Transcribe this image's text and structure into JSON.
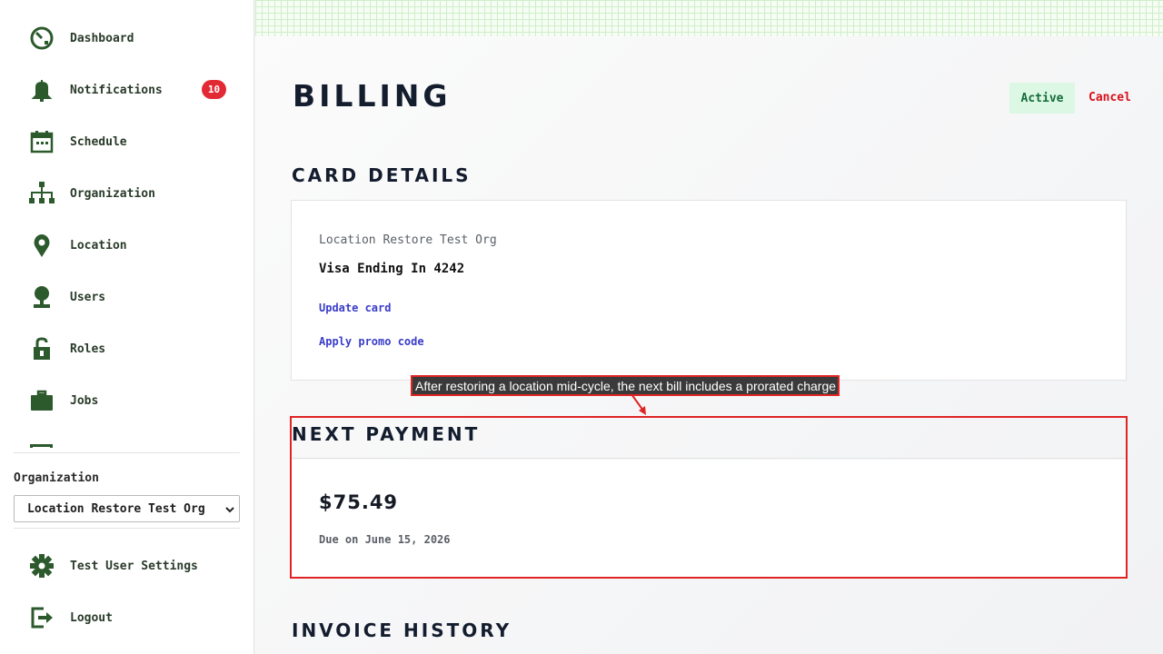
{
  "sidebar": {
    "items": [
      {
        "label": "Dashboard",
        "icon": "dashboard-icon"
      },
      {
        "label": "Notifications",
        "icon": "bell-icon",
        "badge": "10"
      },
      {
        "label": "Schedule",
        "icon": "calendar-icon"
      },
      {
        "label": "Organization",
        "icon": "org-chart-icon"
      },
      {
        "label": "Location",
        "icon": "location-pin-icon"
      },
      {
        "label": "Users",
        "icon": "user-icon"
      },
      {
        "label": "Roles",
        "icon": "lock-icon"
      },
      {
        "label": "Jobs",
        "icon": "briefcase-icon"
      }
    ],
    "org_label": "Organization",
    "org_selected": "Location Restore Test Org",
    "settings_label": "Test User Settings",
    "logout_label": "Logout"
  },
  "header": {
    "title": "BILLING",
    "status": "Active",
    "cancel_label": "Cancel"
  },
  "card_details": {
    "title": "CARD DETAILS",
    "org_name": "Location Restore Test Org",
    "card_text": "Visa Ending In 4242",
    "update_label": "Update card",
    "promo_label": "Apply promo code"
  },
  "annotation": {
    "text": "After restoring a location mid-cycle, the next bill includes a prorated charge"
  },
  "next_payment": {
    "title": "NEXT PAYMENT",
    "amount": "$75.49",
    "due": "Due on June 15, 2026"
  },
  "invoice_history": {
    "title": "INVOICE HISTORY"
  },
  "colors": {
    "nav_icon": "#2d5a2d",
    "badge": "#e22a35",
    "status_bg": "#dcf8e4",
    "status_text": "#146b3a",
    "danger": "#d9101c",
    "link": "#3a3dc8",
    "highlight": "#e02424"
  }
}
